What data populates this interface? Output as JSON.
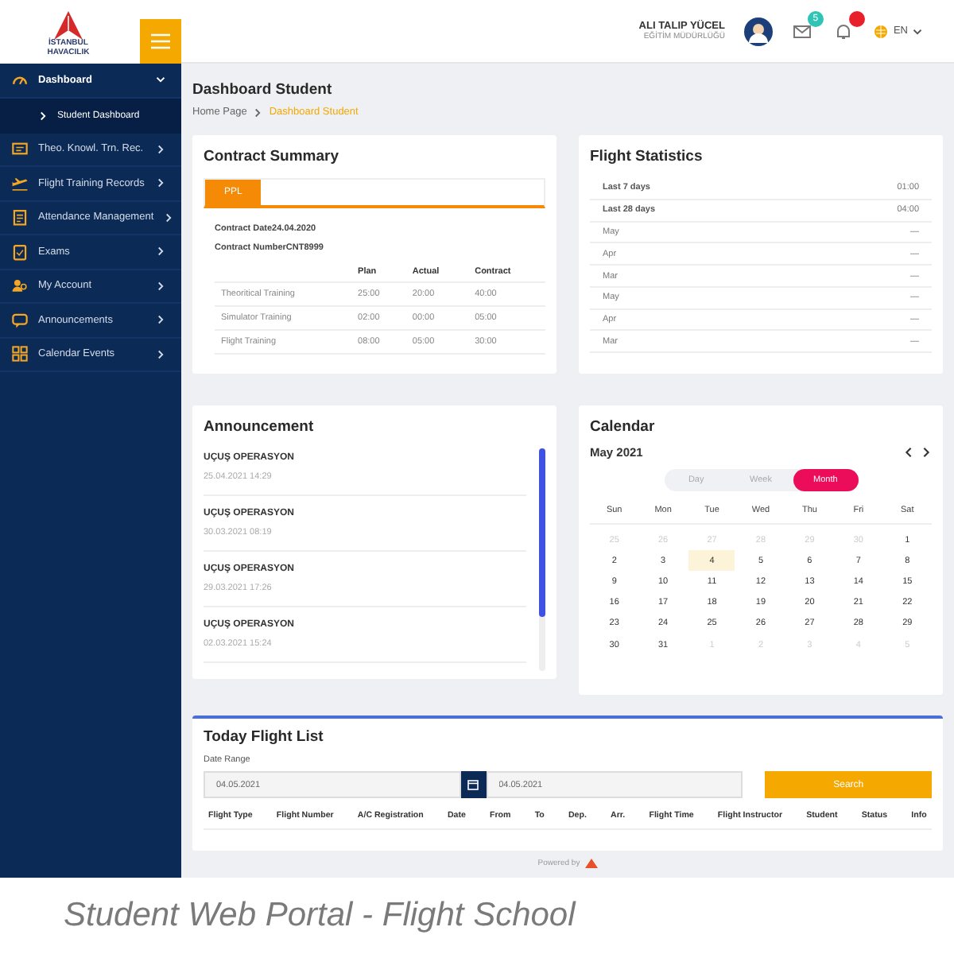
{
  "sidebar": {
    "logo_text": "İSTANBUL HAVACILIK",
    "items": [
      {
        "label": "Dashboard",
        "expanded": true,
        "children": [
          {
            "label": "Student Dashboard",
            "selected": true
          }
        ]
      },
      {
        "label": "Theo. Knowl. Trn. Rec.",
        "expanded": false
      },
      {
        "label": "Flight Training Records",
        "expanded": false
      },
      {
        "label": "Attendance Management",
        "expanded": false
      },
      {
        "label": "Exams",
        "expanded": false
      },
      {
        "label": "My Account",
        "expanded": false
      },
      {
        "label": "Announcements",
        "expanded": false
      },
      {
        "label": "Calendar Events",
        "expanded": false
      }
    ]
  },
  "header": {
    "user_name": "ALI TALIP YÜCEL",
    "user_role": "EĞİTİM MÜDÜRLÜĞÜ",
    "mail_badge": "5",
    "language": "EN"
  },
  "page": {
    "title": "Dashboard Student",
    "breadcrumb": [
      "Home Page",
      "Dashboard Student"
    ]
  },
  "contract_summary": {
    "title": "Contract Summary",
    "tabs": [
      {
        "label": "PPL",
        "selected": true
      }
    ],
    "fields": [
      "Contract Date24.04.2020",
      "Contract NumberCNT8999"
    ],
    "columns": [
      "Plan",
      "Actual",
      "Contract"
    ],
    "rows": [
      {
        "name": "Theoritical Training",
        "cells": [
          "25:00",
          "20:00",
          "40:00"
        ]
      },
      {
        "name": "Simulator Training",
        "cells": [
          "02:00",
          "00:00",
          "05:00"
        ]
      },
      {
        "name": "Flight Training",
        "cells": [
          "08:00",
          "05:00",
          "30:00"
        ]
      }
    ]
  },
  "flight_statistics": {
    "title": "Flight Statistics",
    "rows": [
      {
        "label": "Last 7 days",
        "value": "01:00",
        "bold": true
      },
      {
        "label": "Last 28 days",
        "value": "04:00",
        "bold": true
      },
      {
        "label": "May",
        "value": "—",
        "bold": false
      },
      {
        "label": "Apr",
        "value": "—",
        "bold": false
      },
      {
        "label": "Mar",
        "value": "—",
        "bold": false
      },
      {
        "label": "May",
        "value": "—",
        "bold": false
      },
      {
        "label": "Apr",
        "value": "—",
        "bold": false
      },
      {
        "label": "Mar",
        "value": "—",
        "bold": false
      }
    ]
  },
  "announcement": {
    "title": "Announcement",
    "items": [
      {
        "title": "UÇUŞ OPERASYON",
        "date": "25.04.2021 14:29"
      },
      {
        "title": "UÇUŞ OPERASYON",
        "date": "30.03.2021 08:19"
      },
      {
        "title": "UÇUŞ OPERASYON",
        "date": "29.03.2021 17:26"
      },
      {
        "title": "UÇUŞ OPERASYON",
        "date": "02.03.2021 15:24"
      }
    ]
  },
  "calendar": {
    "title": "Calendar",
    "month": "May 2021",
    "views": [
      {
        "label": "Day",
        "selected": false
      },
      {
        "label": "Week",
        "selected": false
      },
      {
        "label": "Month",
        "selected": true
      }
    ],
    "weekdays": [
      "Sun",
      "Mon",
      "Tue",
      "Wed",
      "Thu",
      "Fri",
      "Sat"
    ],
    "weeks": [
      [
        {
          "label": "25",
          "muted": true,
          "selected": false
        },
        {
          "label": "26",
          "muted": true,
          "selected": false
        },
        {
          "label": "27",
          "muted": true,
          "selected": false
        },
        {
          "label": "28",
          "muted": true,
          "selected": false
        },
        {
          "label": "29",
          "muted": true,
          "selected": false
        },
        {
          "label": "30",
          "muted": true,
          "selected": false
        },
        {
          "label": "1",
          "muted": false,
          "selected": false
        }
      ],
      [
        {
          "label": "2",
          "muted": false,
          "selected": false
        },
        {
          "label": "3",
          "muted": false,
          "selected": false
        },
        {
          "label": "4",
          "muted": false,
          "selected": true
        },
        {
          "label": "5",
          "muted": false,
          "selected": false
        },
        {
          "label": "6",
          "muted": false,
          "selected": false
        },
        {
          "label": "7",
          "muted": false,
          "selected": false
        },
        {
          "label": "8",
          "muted": false,
          "selected": false
        }
      ],
      [
        {
          "label": "9",
          "muted": false,
          "selected": false
        },
        {
          "label": "10",
          "muted": false,
          "selected": false
        },
        {
          "label": "11",
          "muted": false,
          "selected": false
        },
        {
          "label": "12",
          "muted": false,
          "selected": false
        },
        {
          "label": "13",
          "muted": false,
          "selected": false
        },
        {
          "label": "14",
          "muted": false,
          "selected": false
        },
        {
          "label": "15",
          "muted": false,
          "selected": false
        }
      ],
      [
        {
          "label": "16",
          "muted": false,
          "selected": false
        },
        {
          "label": "17",
          "muted": false,
          "selected": false
        },
        {
          "label": "18",
          "muted": false,
          "selected": false
        },
        {
          "label": "19",
          "muted": false,
          "selected": false
        },
        {
          "label": "20",
          "muted": false,
          "selected": false
        },
        {
          "label": "21",
          "muted": false,
          "selected": false
        },
        {
          "label": "22",
          "muted": false,
          "selected": false
        }
      ],
      [
        {
          "label": "23",
          "muted": false,
          "selected": false
        },
        {
          "label": "24",
          "muted": false,
          "selected": false
        },
        {
          "label": "25",
          "muted": false,
          "selected": false
        },
        {
          "label": "26",
          "muted": false,
          "selected": false
        },
        {
          "label": "27",
          "muted": false,
          "selected": false
        },
        {
          "label": "28",
          "muted": false,
          "selected": false
        },
        {
          "label": "29",
          "muted": false,
          "selected": false
        }
      ],
      [
        {
          "label": "30",
          "muted": false,
          "selected": false
        },
        {
          "label": "31",
          "muted": false,
          "selected": false
        },
        {
          "label": "1",
          "muted": true,
          "selected": false
        },
        {
          "label": "2",
          "muted": true,
          "selected": false
        },
        {
          "label": "3",
          "muted": true,
          "selected": false
        },
        {
          "label": "4",
          "muted": true,
          "selected": false
        },
        {
          "label": "5",
          "muted": true,
          "selected": false
        }
      ]
    ]
  },
  "flight_list": {
    "title": "Today Flight List",
    "date_range_label": "Date Range",
    "date_from": "04.05.2021",
    "date_to": "04.05.2021",
    "search_button": "Search",
    "columns": [
      "Flight Type",
      "Flight Number",
      "A/C Registration",
      "Date",
      "From",
      "To",
      "Dep.",
      "Arr.",
      "Flight Time",
      "Flight Instructor",
      "Student",
      "Status",
      "Info"
    ]
  },
  "footer": {
    "powered_by": "Powered by"
  },
  "caption": "Student Web Portal - Flight School"
}
